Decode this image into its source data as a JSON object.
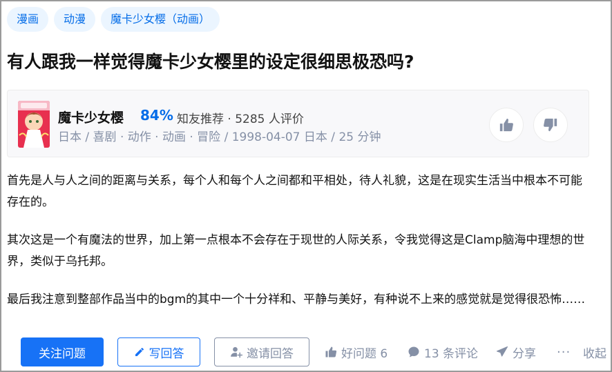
{
  "tags": [
    "漫画",
    "动漫",
    "魔卡少女樱（动画）"
  ],
  "question": {
    "title": "有人跟我一样觉得魔卡少女樱里的设定很细思极恐吗?"
  },
  "card": {
    "name": "魔卡少女樱",
    "score": "84%",
    "recommend_text": "知友推荐 · 5285 人评价",
    "meta": "日本 / 喜剧 · 动作 · 动画 · 冒险 / 1998-04-07 日本 / 25 分钟",
    "icons": {
      "up": "thumbs-up-icon",
      "down": "thumbs-down-icon"
    }
  },
  "paragraphs": [
    "首先是人与人之间的距离与关系，每个人和每个人之间都和平相处，待人礼貌，这是在现实生活当中根本不可能存在的。",
    "其次这是一个有魔法的世界，加上第一点根本不会存在于现世的人际关系，令我觉得这是Clamp脑海中理想的世界，类似于乌托邦。",
    "最后我注意到整部作品当中的bgm的其中一个十分祥和、平静与美好，有种说不上来的感觉就是觉得很恐怖……"
  ],
  "actions": {
    "follow": "关注问题",
    "answer": "写回答",
    "invite": "邀请回答",
    "good": "好问题 6",
    "comments": "13 条评论",
    "share": "分享",
    "more": "···",
    "collapse": "收起"
  },
  "colors": {
    "accent": "#1772f6",
    "tag_bg": "#ebf5ff",
    "muted": "#8590a6"
  }
}
